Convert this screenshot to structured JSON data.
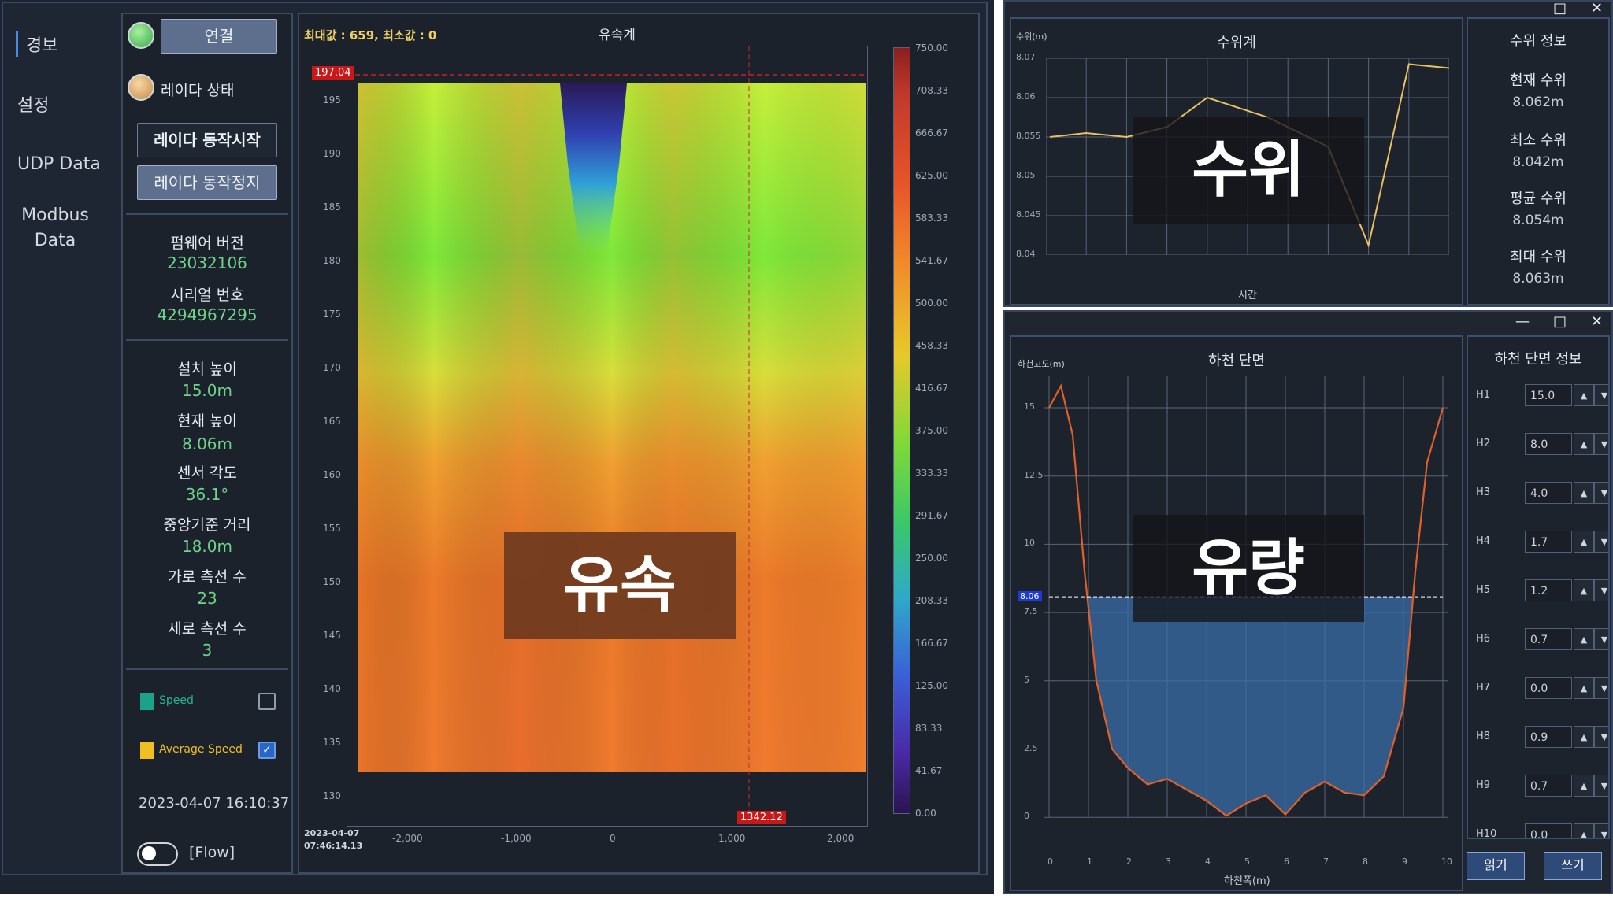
{
  "nav": {
    "items": [
      "경보",
      "설정",
      "UDP Data",
      "Modbus Data"
    ]
  },
  "controls": {
    "connect_label": "연결",
    "radar_status_label": "레이다 상태",
    "start_label": "레이다 동작시작",
    "stop_label": "레이다 동작정지",
    "firmware_label": "펌웨어 버전",
    "firmware_value": "23032106",
    "serial_label": "시리얼 번호",
    "serial_value": "4294967295",
    "install_height_label": "설치 높이",
    "install_height_value": "15.0m",
    "current_height_label": "현재 높이",
    "current_height_value": "8.06m",
    "sensor_angle_label": "센서 각도",
    "sensor_angle_value": "36.1°",
    "center_distance_label": "중앙기준 거리",
    "center_distance_value": "18.0m",
    "horiz_lines_label": "가로 측선 수",
    "horiz_lines_value": "23",
    "vert_lines_label": "세로 측선 수",
    "vert_lines_value": "3",
    "legend_speed": "Speed",
    "legend_avg_speed": "Average Speed",
    "datetime": "2023-04-07 16:10:37",
    "toggle_label": "[Flow]",
    "colors": {
      "connected": "#49c45a",
      "status": "#e0a040",
      "speed": "#1aa38a",
      "avg_speed": "#f0c020"
    }
  },
  "heatmap": {
    "header": "최대값 : 659, 최소값 : 0",
    "title": "유속계",
    "overlay": "유속",
    "marker_y": "197.04",
    "marker_x": "1342.12",
    "y_ticks": [
      "195",
      "190",
      "185",
      "180",
      "175",
      "170",
      "165",
      "160",
      "155",
      "150",
      "145",
      "140",
      "135",
      "130"
    ],
    "x_ticks": [
      "-2,000",
      "-1,000",
      "0",
      "1,000",
      "2,000"
    ],
    "colorbar_ticks": [
      "750.00",
      "708.33",
      "666.67",
      "625.00",
      "583.33",
      "541.67",
      "500.00",
      "458.33",
      "416.67",
      "375.00",
      "333.33",
      "291.67",
      "250.00",
      "208.33",
      "166.67",
      "125.00",
      "83.33",
      "41.67",
      "0.00"
    ],
    "footer_date": "2023-04-07",
    "footer_time": "07:46:14.13"
  },
  "water_level": {
    "title": "수위계",
    "overlay": "수위",
    "ylabel": "수위(m)",
    "xlabel": "시간",
    "y_ticks": [
      "8.07",
      "8.06",
      "8.055",
      "8.05",
      "8.045",
      "8.04"
    ],
    "info_title": "수위 정보",
    "current_label": "현재 수위",
    "current_value": "8.062m",
    "min_label": "최소 수위",
    "min_value": "8.042m",
    "avg_label": "평균 수위",
    "avg_value": "8.054m",
    "max_label": "최대 수위",
    "max_value": "8.063m"
  },
  "cross_section": {
    "title": "하천 단면",
    "overlay": "유량",
    "ylabel": "하천고도(m)",
    "xlabel": "하천폭(m)",
    "water_marker": "8.06",
    "y_ticks": [
      "15",
      "12.5",
      "10",
      "7.5",
      "5",
      "2.5",
      "0"
    ],
    "x_ticks": [
      "0",
      "1",
      "2",
      "3",
      "4",
      "5",
      "6",
      "7",
      "8",
      "9",
      "10"
    ],
    "info_title": "하천 단면 정보",
    "rows": [
      {
        "label": "H1",
        "value": "15.0"
      },
      {
        "label": "H2",
        "value": "8.0"
      },
      {
        "label": "H3",
        "value": "4.0"
      },
      {
        "label": "H4",
        "value": "1.7"
      },
      {
        "label": "H5",
        "value": "1.2"
      },
      {
        "label": "H6",
        "value": "0.7"
      },
      {
        "label": "H7",
        "value": "0.0"
      },
      {
        "label": "H8",
        "value": "0.9"
      },
      {
        "label": "H9",
        "value": "0.7"
      },
      {
        "label": "H10",
        "value": "0.0"
      }
    ],
    "read_label": "읽기",
    "write_label": "쓰기"
  }
}
